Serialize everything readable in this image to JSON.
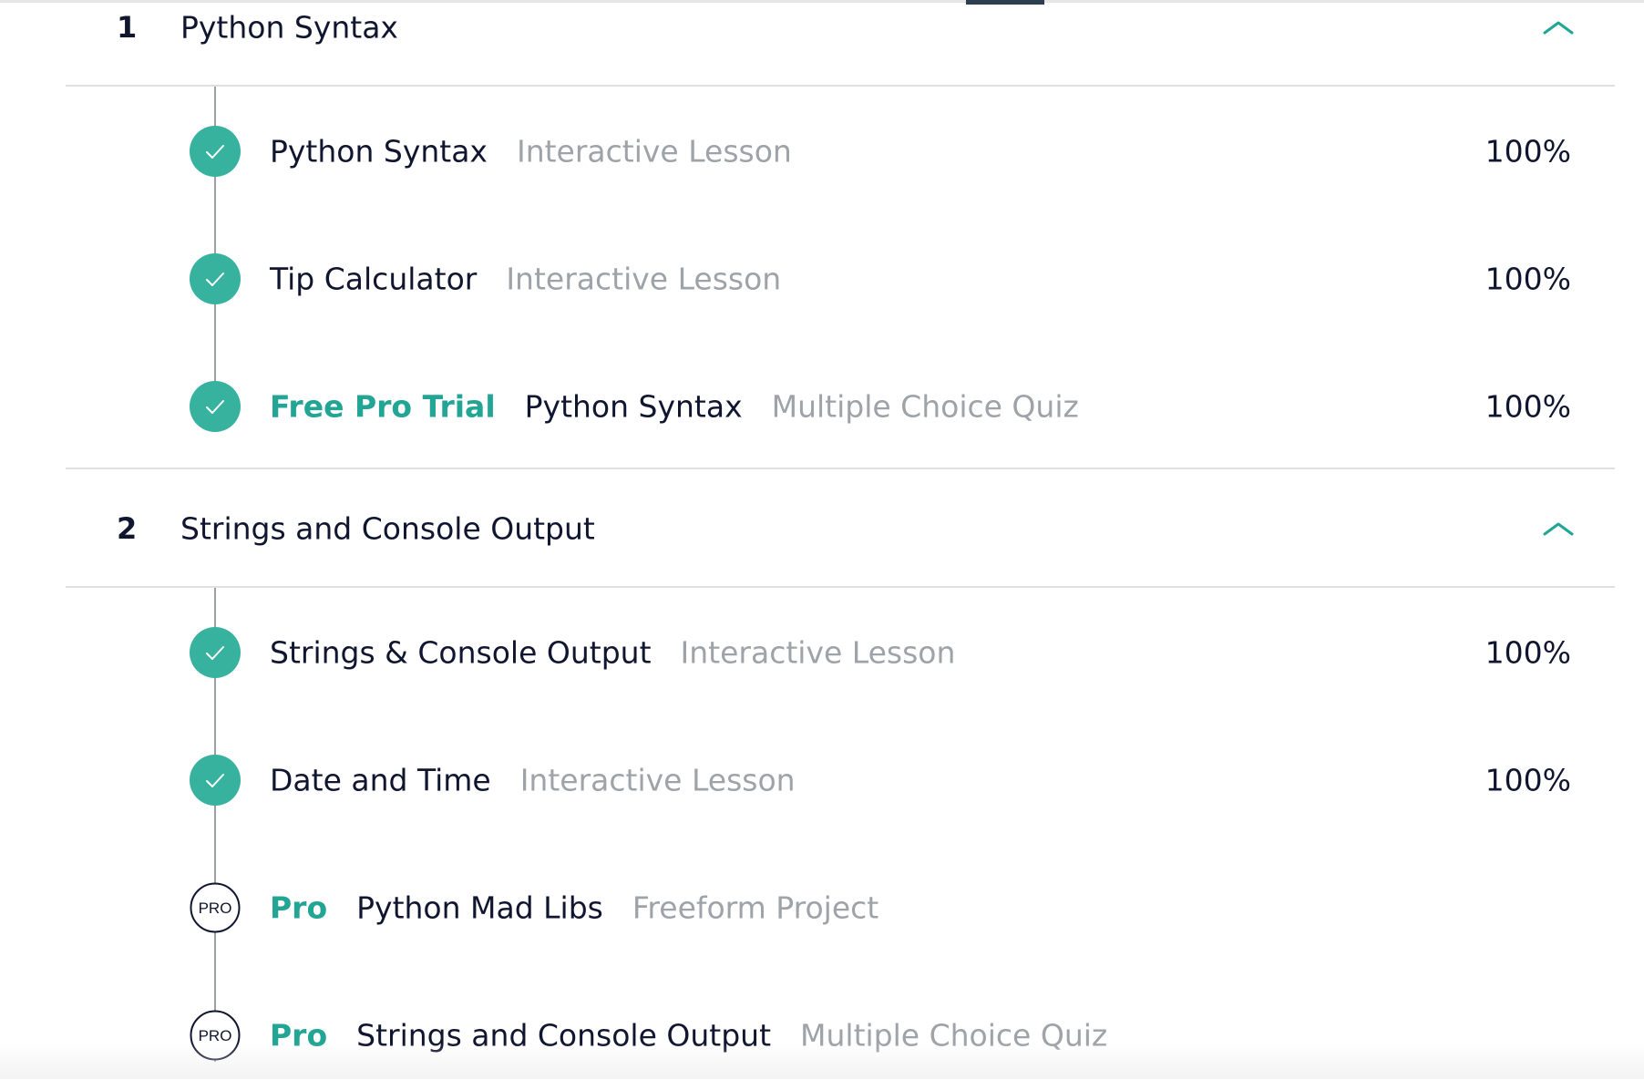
{
  "colors": {
    "accent": "#22a594",
    "text": "#10162f",
    "muted": "#9da3a8",
    "divider": "#e0e0e0"
  },
  "sections": [
    {
      "number": "1",
      "title": "Python Syntax",
      "expanded": true,
      "lessons": [
        {
          "badge": "",
          "name": "Python Syntax",
          "type": "Interactive Lesson",
          "percent": "100%",
          "status": "completed",
          "icon": "check-icon"
        },
        {
          "badge": "",
          "name": "Tip Calculator",
          "type": "Interactive Lesson",
          "percent": "100%",
          "status": "completed",
          "icon": "check-icon"
        },
        {
          "badge": "Free Pro Trial",
          "name": "Python Syntax",
          "type": "Multiple Choice Quiz",
          "percent": "100%",
          "status": "completed",
          "icon": "check-icon"
        }
      ]
    },
    {
      "number": "2",
      "title": "Strings and Console Output",
      "expanded": true,
      "lessons": [
        {
          "badge": "",
          "name": "Strings & Console Output",
          "type": "Interactive Lesson",
          "percent": "100%",
          "status": "completed",
          "icon": "check-icon"
        },
        {
          "badge": "",
          "name": "Date and Time",
          "type": "Interactive Lesson",
          "percent": "100%",
          "status": "completed",
          "icon": "check-icon"
        },
        {
          "badge": "Pro",
          "name": "Python Mad Libs",
          "type": "Freeform Project",
          "percent": "",
          "status": "locked",
          "icon": "pro-icon",
          "icon_label": "PRO"
        },
        {
          "badge": "Pro",
          "name": "Strings and Console Output",
          "type": "Multiple Choice Quiz",
          "percent": "",
          "status": "locked",
          "icon": "pro-icon",
          "icon_label": "PRO"
        }
      ]
    }
  ]
}
